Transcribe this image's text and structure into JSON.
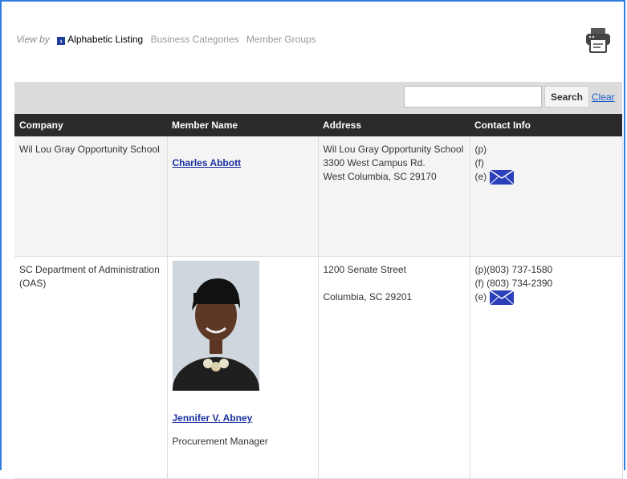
{
  "view_by": {
    "label": "View by",
    "active": "Alphabetic Listing",
    "options": [
      "Business Categories",
      "Member Groups"
    ]
  },
  "search": {
    "placeholder": "",
    "button": "Search",
    "clear": "Clear"
  },
  "table": {
    "headers": [
      "Company",
      "Member Name",
      "Address",
      "Contact Info"
    ],
    "rows": [
      {
        "company": "Wil Lou Gray Opportunity School",
        "member": "Charles Abbott",
        "title": "",
        "address": [
          "Wil Lou Gray Opportunity School",
          "3300 West Campus Rd.",
          "West Columbia, SC  29170"
        ],
        "phone": "(p)",
        "fax": "(f)",
        "email": "(e)"
      },
      {
        "company": "SC Department of Administration (OAS)",
        "member": "Jennifer V. Abney",
        "title": "Procurement Manager",
        "address": [
          "1200 Senate Street",
          "",
          "Columbia, SC  29201"
        ],
        "phone": "(p)(803) 737-1580",
        "fax": "(f) (803) 734-2390",
        "email": "(e)"
      }
    ]
  },
  "icons": {
    "printer": "printer-icon",
    "email": "envelope-icon",
    "arrow": "arrow-right-icon"
  },
  "colors": {
    "header_bg": "#2b2b2b",
    "link": "#1a2fa0",
    "frame": "#2f7de1",
    "envelope": "#2a3fb8"
  }
}
